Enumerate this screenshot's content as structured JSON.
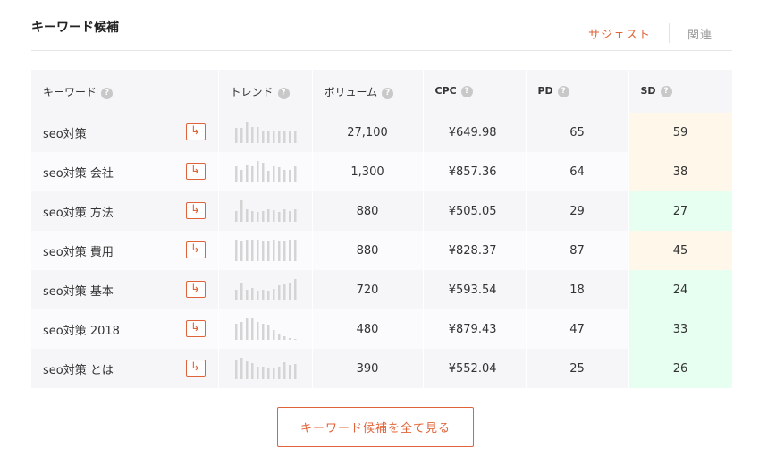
{
  "header": {
    "title": "キーワード候補",
    "tabs": [
      {
        "label": "サジェスト",
        "active": true
      },
      {
        "label": "関連",
        "active": false
      }
    ]
  },
  "table": {
    "columns": [
      "キーワード",
      "トレンド",
      "ボリューム",
      "CPC",
      "PD",
      "SD"
    ],
    "help_glyph": "?",
    "rows": [
      {
        "keyword": "seo対策",
        "volume": "27,100",
        "cpc": "¥649.98",
        "pd": "65",
        "sd": "59",
        "sd_level": "warn",
        "trend": [
          0.7,
          0.7,
          1.0,
          0.75,
          0.75,
          0.55,
          0.55,
          0.6,
          0.6,
          0.6,
          0.55,
          0.6
        ]
      },
      {
        "keyword": "seo対策 会社",
        "volume": "1,300",
        "cpc": "¥857.36",
        "pd": "64",
        "sd": "38",
        "sd_level": "warn",
        "trend": [
          0.75,
          0.6,
          0.85,
          0.75,
          1.0,
          0.9,
          0.55,
          0.75,
          0.7,
          0.6,
          0.6,
          0.75
        ]
      },
      {
        "keyword": "seo対策 方法",
        "volume": "880",
        "cpc": "¥505.05",
        "pd": "29",
        "sd": "27",
        "sd_level": "good",
        "trend": [
          0.5,
          1.0,
          0.6,
          0.5,
          0.45,
          0.5,
          0.6,
          0.55,
          0.45,
          0.6,
          0.5,
          0.6
        ]
      },
      {
        "keyword": "seo対策 費用",
        "volume": "880",
        "cpc": "¥828.37",
        "pd": "87",
        "sd": "45",
        "sd_level": "warn",
        "trend": [
          1.0,
          0.9,
          1.0,
          1.0,
          1.0,
          0.95,
          0.9,
          1.0,
          0.95,
          0.9,
          1.0,
          1.0
        ]
      },
      {
        "keyword": "seo対策 基本",
        "volume": "720",
        "cpc": "¥593.54",
        "pd": "18",
        "sd": "24",
        "sd_level": "good",
        "trend": [
          0.5,
          0.85,
          0.5,
          0.6,
          0.45,
          0.5,
          0.45,
          0.55,
          0.7,
          0.8,
          0.85,
          1.0
        ]
      },
      {
        "keyword": "seo対策 2018",
        "volume": "480",
        "cpc": "¥879.43",
        "pd": "47",
        "sd": "33",
        "sd_level": "good",
        "trend": [
          0.75,
          0.85,
          1.0,
          1.0,
          0.85,
          0.75,
          0.7,
          0.45,
          0.25,
          0.15,
          0.1,
          0.05
        ]
      },
      {
        "keyword": "seo対策 とは",
        "volume": "390",
        "cpc": "¥552.04",
        "pd": "25",
        "sd": "26",
        "sd_level": "good",
        "trend": [
          0.9,
          1.0,
          0.85,
          0.75,
          0.6,
          0.6,
          0.5,
          0.55,
          0.6,
          0.8,
          0.65,
          0.7
        ]
      }
    ]
  },
  "goto_glyph": "↳",
  "more_button": "キーワード候補を全て見る"
}
